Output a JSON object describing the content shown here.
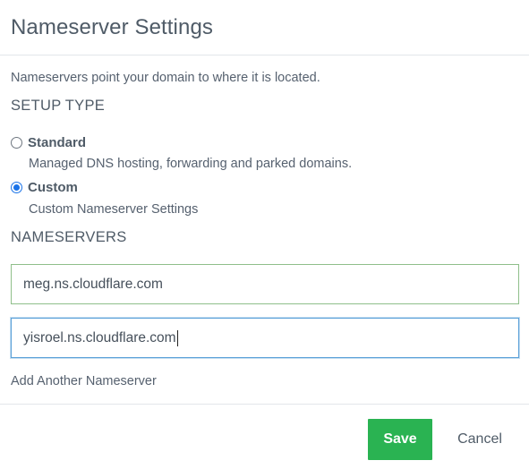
{
  "dialog": {
    "title": "Nameserver Settings",
    "description": "Nameservers point your domain to where it is located."
  },
  "setup_type": {
    "heading": "SETUP TYPE",
    "options": [
      {
        "label": "Standard",
        "description": "Managed DNS hosting, forwarding and parked domains.",
        "selected": false
      },
      {
        "label": "Custom",
        "description": "Custom Nameserver Settings",
        "selected": true
      }
    ]
  },
  "nameservers": {
    "heading": "NAMESERVERS",
    "entries": [
      {
        "value": "meg.ns.cloudflare.com"
      },
      {
        "value": "yisroel.ns.cloudflare.com"
      }
    ],
    "add_label": "Add Another Nameserver"
  },
  "footer": {
    "save_label": "Save",
    "cancel_label": "Cancel"
  },
  "colors": {
    "accent": "#2ab352",
    "radio_selected": "#1a73e8",
    "input_valid_border": "#8fbf8a",
    "input_focus_border": "#5aa0d8"
  }
}
